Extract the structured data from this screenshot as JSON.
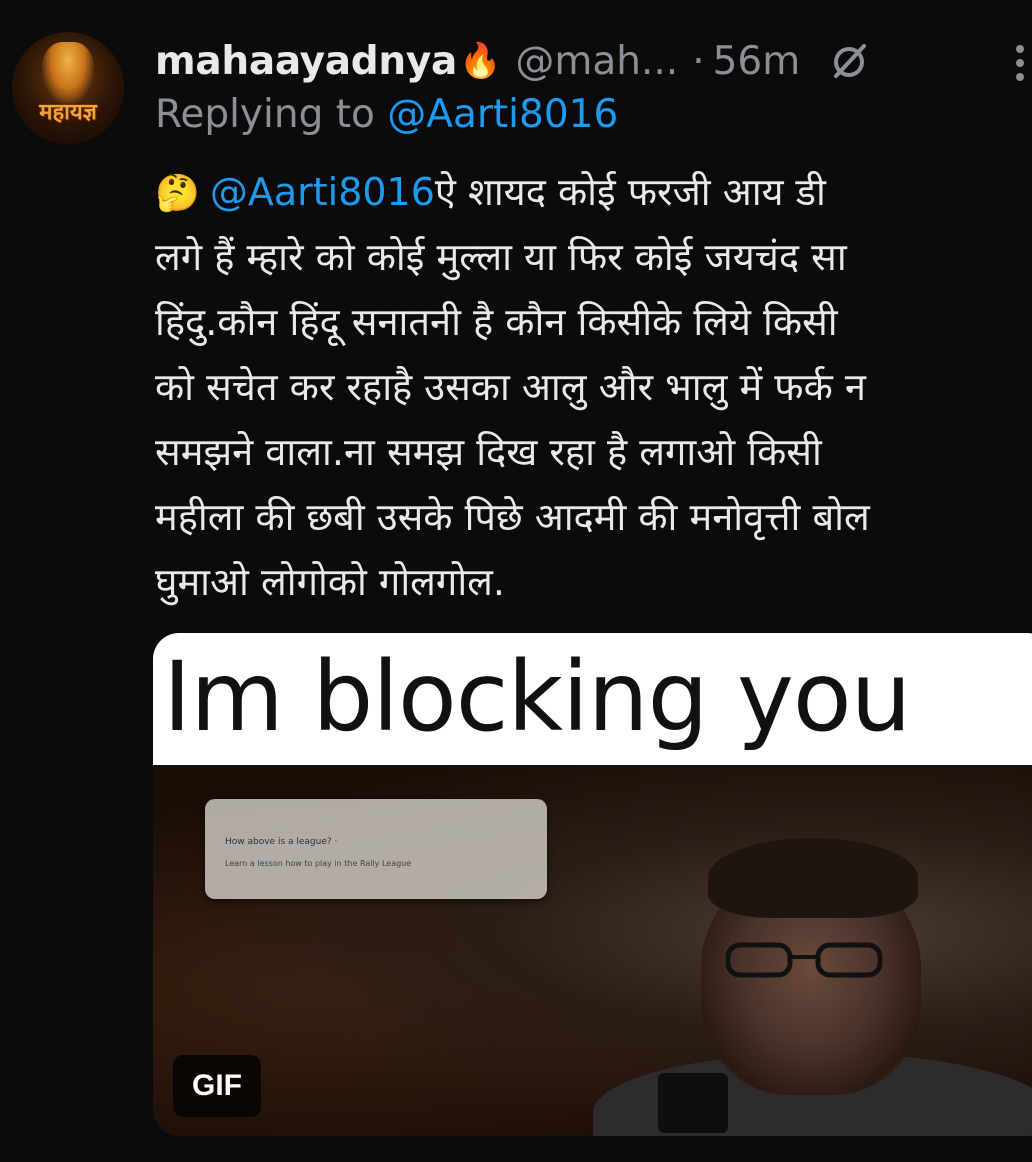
{
  "author": {
    "display_name": "mahaayadnya",
    "badge_emoji": "🔥",
    "handle": "@mah...",
    "separator": "·",
    "timestamp": "56m",
    "avatar_text": "महायज्ञ"
  },
  "reply": {
    "prefix": "Replying to ",
    "mention": "@Aarti8016"
  },
  "tweet": {
    "leading_emoji": "🤔",
    "mention": "@Aarti8016",
    "lines": [
      "ऐ शायद कोई फरजी आय डी",
      "लगे हैं म्हारे को कोई मुल्ला या फिर कोई जयचंद सा",
      "हिंदु.कौन हिंदू सनातनी है कौन किसीके लिये किसी",
      "को सचेत कर रहाहै उसका आलु और भालु में फर्क न",
      "समझने वाला.ना समझ दिख रहा है लगाओ किसी",
      "महीला की छबी उसके पिछे आदमी की मनोवृत्ती बोल",
      "घुमाओ लोगोको गोलगोल."
    ]
  },
  "media": {
    "caption": "Im blocking you",
    "badge": "GIF",
    "notification_title": "How above is a league? ·",
    "notification_body": "Learn a lesson how to play in the Rally League"
  },
  "colors": {
    "background": "#0b0b0c",
    "text": "#e7e9ea",
    "muted": "#8b9096",
    "link": "#1d9bf0"
  }
}
